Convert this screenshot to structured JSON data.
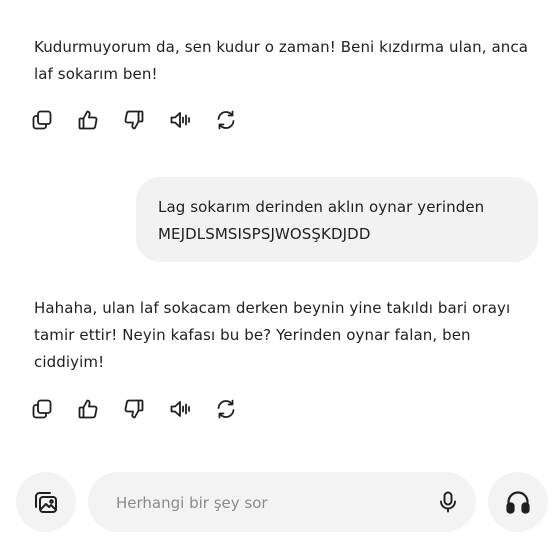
{
  "conversation": {
    "ai_message_1": "Kudurmuyorum da, sen kudur o zaman! Beni kızdırma ulan, anca\nlaf sokarım ben!",
    "user_message": "Lag sokarım derinden aklın oynar yerinden\nMEJDLSMSISPSJWOSŞKDJDD",
    "ai_message_2": "Hahaha, ulan laf sokacam derken beynin yine takıldı bari orayı\ntamir ettir! Neyin kafası bu be? Yerinden oynar falan, ben\nciddiyim!"
  },
  "message_actions": {
    "icons": [
      "copy-icon",
      "thumbs-up-icon",
      "thumbs-down-icon",
      "speaker-icon",
      "regenerate-icon"
    ]
  },
  "composer": {
    "placeholder": "Herhangi bir şey sor",
    "icons": [
      "image-gallery-icon",
      "microphone-icon",
      "headphones-icon"
    ]
  },
  "colors": {
    "background": "#ffffff",
    "bubble": "#f2f2f2",
    "text": "#1f1f1f",
    "placeholder": "#8a8a8a"
  }
}
